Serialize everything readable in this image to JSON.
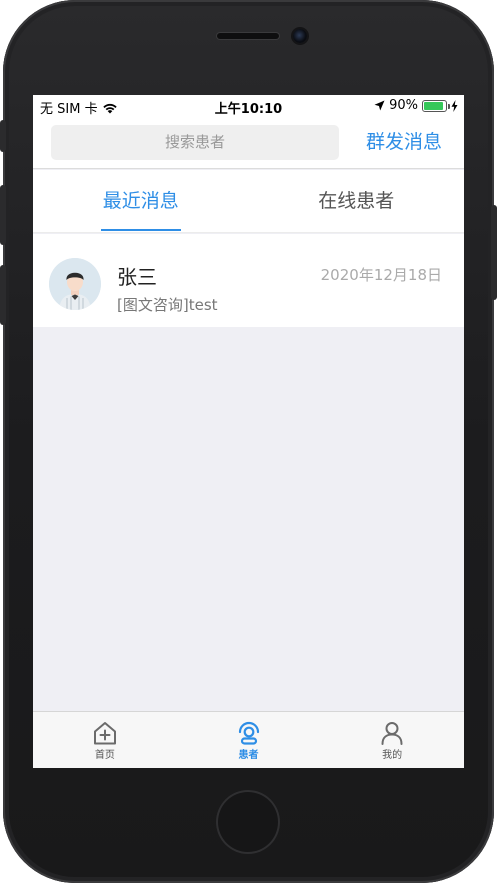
{
  "status_bar": {
    "carrier": "无 SIM 卡",
    "time": "上午10:10",
    "battery": "90%",
    "battery_level": 0.9,
    "icons": [
      "wifi-icon",
      "location-arrow-icon",
      "battery-icon",
      "charging-icon"
    ]
  },
  "header": {
    "search_placeholder": "搜索患者",
    "broadcast_label": "群发消息"
  },
  "tabs": [
    {
      "label": "最近消息",
      "active": true
    },
    {
      "label": "在线患者",
      "active": false
    }
  ],
  "messages": [
    {
      "name": "张三",
      "date": "2020年12月18日",
      "preview": "[图文咨询]test",
      "avatar_icon": "doctor-avatar"
    }
  ],
  "tabbar": [
    {
      "label": "首页",
      "icon": "home-plus-icon",
      "active": false
    },
    {
      "label": "患者",
      "icon": "patient-icon",
      "active": true
    },
    {
      "label": "我的",
      "icon": "person-icon",
      "active": false
    }
  ],
  "colors": {
    "accent": "#2e8ee6",
    "background": "#efeff4",
    "battery": "#35c759"
  }
}
